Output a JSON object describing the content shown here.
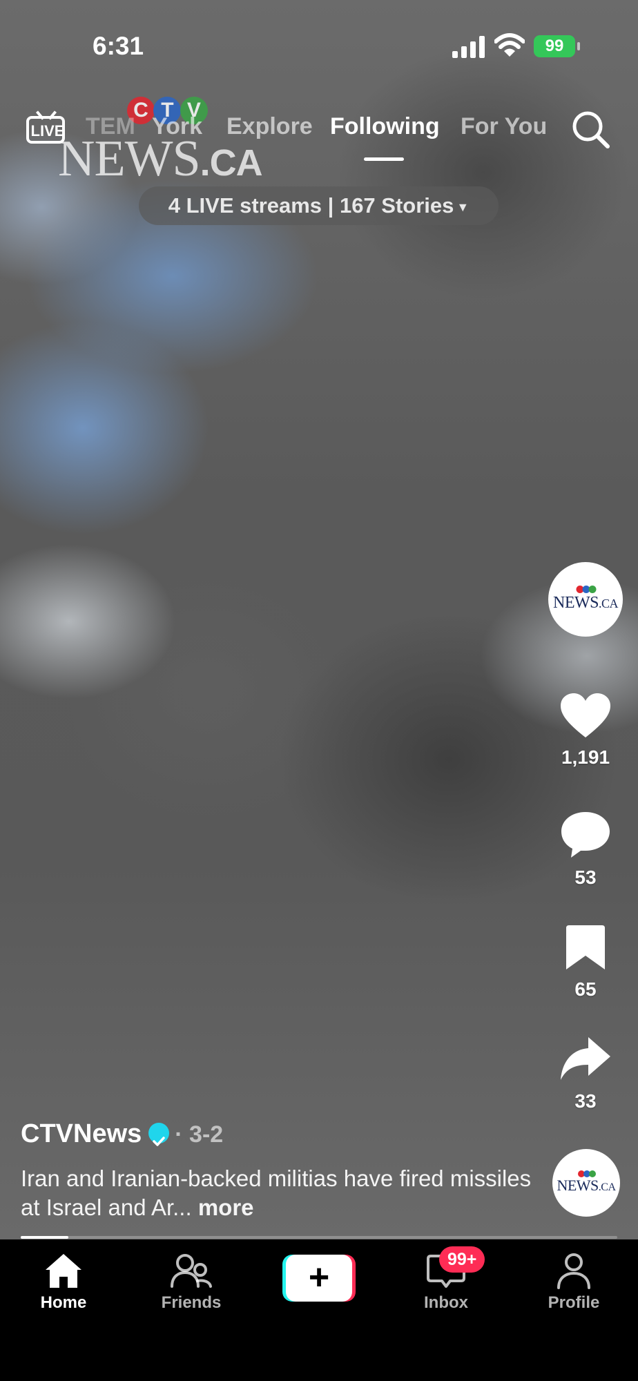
{
  "status_bar": {
    "time": "6:31",
    "battery": "99"
  },
  "watermark": {
    "dots": [
      "C",
      "T",
      "V"
    ],
    "word": "NEWS",
    "suffix": ".CA"
  },
  "top_nav": {
    "live_label": "LIVE",
    "tabs": [
      "TEM",
      "York",
      "Explore",
      "Following",
      "For You"
    ],
    "active_tab": "Following"
  },
  "live_pill": {
    "label": "4 LIVE streams | 167 Stories"
  },
  "side_actions": {
    "likes": "1,191",
    "comments": "53",
    "saves": "65",
    "shares": "33"
  },
  "mini_logo": {
    "word": "NEWS",
    "suffix": ".CA"
  },
  "post": {
    "author": "CTVNews",
    "date": "· 3-2",
    "text": "Iran and Iranian-backed militias have fired missiles at Israel and Ar...",
    "more": "more",
    "progress": 0.08
  },
  "bottom_nav": {
    "items": [
      {
        "label": "Home"
      },
      {
        "label": "Friends"
      },
      {
        "label": "Inbox"
      },
      {
        "label": "Profile"
      }
    ],
    "inbox_badge": "99+"
  },
  "colors": {
    "ctv_red": "#e2262f",
    "ctv_blue": "#2b65c4",
    "ctv_green": "#3aa345",
    "verified": "#20d5ec",
    "badge": "#fe2c55",
    "battery": "#34c759"
  }
}
